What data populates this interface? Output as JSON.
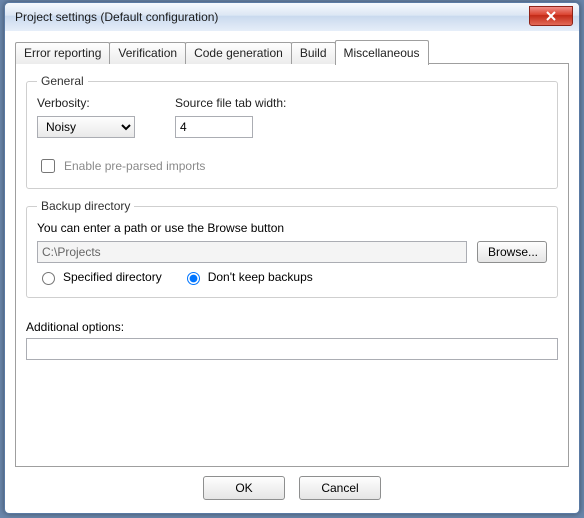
{
  "window": {
    "title": "Project settings (Default configuration)"
  },
  "tabs": {
    "error_reporting": "Error reporting",
    "verification": "Verification",
    "code_generation": "Code generation",
    "build": "Build",
    "miscellaneous": "Miscellaneous",
    "active": "miscellaneous"
  },
  "general": {
    "legend": "General",
    "verbosity_label": "Verbosity:",
    "verbosity_value": "Noisy",
    "tabwidth_label": "Source file tab width:",
    "tabwidth_value": "4",
    "enable_preparsed_label": "Enable pre-parsed imports",
    "enable_preparsed_checked": false
  },
  "backup": {
    "legend": "Backup directory",
    "hint": "You can enter a path or use the Browse button",
    "path_value": "C:\\Projects",
    "browse_label": "Browse...",
    "radio_specified_label": "Specified directory",
    "radio_dontkeep_label": "Don't keep backups",
    "selected": "dontkeep"
  },
  "additional": {
    "label": "Additional options:",
    "value": ""
  },
  "buttons": {
    "ok": "OK",
    "cancel": "Cancel"
  }
}
